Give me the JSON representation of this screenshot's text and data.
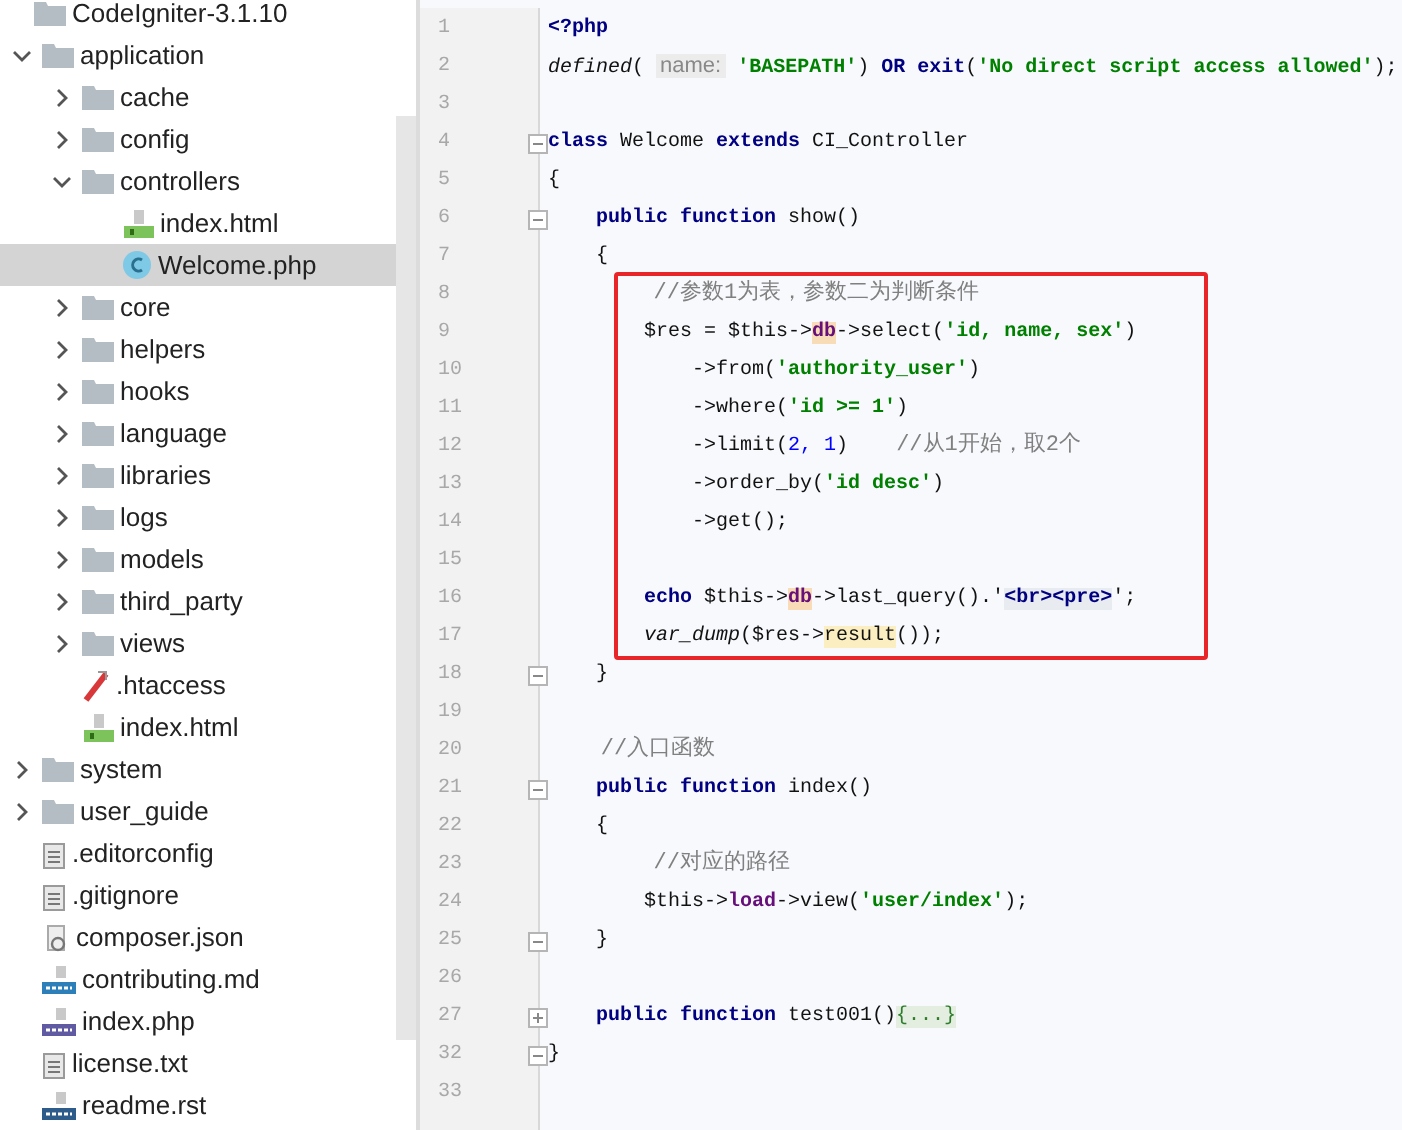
{
  "tree": [
    {
      "label": "CodeIgniter-3.1.10",
      "kind": "folder",
      "selected": false,
      "children": [
        {
          "label": "application",
          "kind": "folder",
          "expanded": true,
          "selected": false,
          "children": [
            {
              "label": "cache",
              "kind": "folder",
              "expanded": false,
              "selected": false
            },
            {
              "label": "config",
              "kind": "folder",
              "expanded": false,
              "selected": false
            },
            {
              "label": "controllers",
              "kind": "folder",
              "expanded": true,
              "selected": false,
              "children": [
                {
                  "label": "index.html",
                  "kind": "html",
                  "selected": false
                },
                {
                  "label": "Welcome.php",
                  "kind": "php-class",
                  "selected": true
                }
              ]
            },
            {
              "label": "core",
              "kind": "folder",
              "expanded": false,
              "selected": false
            },
            {
              "label": "helpers",
              "kind": "folder",
              "expanded": false,
              "selected": false
            },
            {
              "label": "hooks",
              "kind": "folder",
              "expanded": false,
              "selected": false
            },
            {
              "label": "language",
              "kind": "folder",
              "expanded": false,
              "selected": false
            },
            {
              "label": "libraries",
              "kind": "folder",
              "expanded": false,
              "selected": false
            },
            {
              "label": "logs",
              "kind": "folder",
              "expanded": false,
              "selected": false
            },
            {
              "label": "models",
              "kind": "folder",
              "expanded": false,
              "selected": false
            },
            {
              "label": "third_party",
              "kind": "folder",
              "expanded": false,
              "selected": false
            },
            {
              "label": "views",
              "kind": "folder",
              "expanded": false,
              "selected": false
            },
            {
              "label": ".htaccess",
              "kind": "htaccess",
              "selected": false
            },
            {
              "label": "index.html",
              "kind": "html",
              "selected": false
            }
          ]
        },
        {
          "label": "system",
          "kind": "folder",
          "expanded": false,
          "selected": false
        },
        {
          "label": "user_guide",
          "kind": "folder",
          "expanded": false,
          "selected": false
        },
        {
          "label": ".editorconfig",
          "kind": "text",
          "selected": false
        },
        {
          "label": ".gitignore",
          "kind": "text",
          "selected": false
        },
        {
          "label": "composer.json",
          "kind": "json",
          "selected": false
        },
        {
          "label": "contributing.md",
          "kind": "md",
          "selected": false
        },
        {
          "label": "index.php",
          "kind": "php",
          "selected": false
        },
        {
          "label": "license.txt",
          "kind": "text",
          "selected": false
        },
        {
          "label": "readme.rst",
          "kind": "rst",
          "selected": false
        }
      ]
    }
  ],
  "editor": {
    "blocks": [
      {
        "lines": [
          {
            "number": "1",
            "kind": "plain",
            "tokens": [
              {
                "kind": "keyword",
                "text": "<?php"
              }
            ]
          },
          {
            "number": "2",
            "kind": "plain",
            "tokens": [
              {
                "kind": "italic",
                "text": "defined"
              },
              {
                "kind": "plain",
                "text": "( "
              },
              {
                "kind": "hint",
                "text": "name:"
              },
              {
                "kind": "string",
                "text": " 'BASEPATH'"
              },
              {
                "kind": "plain",
                "text": ") "
              },
              {
                "kind": "keyword",
                "text": "OR exit"
              },
              {
                "kind": "plain",
                "text": "("
              },
              {
                "kind": "string",
                "text": "'No direct script access allowed'"
              },
              {
                "kind": "plain",
                "text": ");"
              }
            ]
          },
          {
            "number": "3",
            "kind": "plain"
          },
          {
            "number": "4",
            "kind": "opener",
            "tokens": [
              {
                "kind": "keyword",
                "text": "class"
              },
              {
                "kind": "plain",
                "text": " Welcome "
              },
              {
                "kind": "keyword",
                "text": "extends"
              },
              {
                "kind": "plain",
                "text": " CI_Controller"
              }
            ]
          },
          {
            "number": "5",
            "kind": "plain",
            "tokens": [
              {
                "kind": "plain",
                "text": "{"
              }
            ]
          },
          {
            "number": "6",
            "kind": "opener",
            "tokens": [
              {
                "kind": "keyword",
                "text": "    public function"
              },
              {
                "kind": "plain",
                "text": " show()"
              }
            ]
          },
          {
            "number": "7",
            "kind": "plain",
            "tokens": [
              {
                "kind": "plain",
                "text": "    {"
              }
            ]
          }
        ]
      },
      {
        "boxed": true,
        "lines": [
          {
            "number": "8",
            "kind": "plain",
            "tokens": [
              {
                "kind": "comment",
                "text": "        //参数1为表，参数二为判断条件"
              }
            ]
          },
          {
            "number": "9",
            "kind": "plain",
            "tokens": [
              {
                "kind": "plain",
                "text": "        $res = $this->"
              },
              {
                "kind": "field-marked",
                "text": "db"
              },
              {
                "kind": "plain",
                "text": "->select("
              },
              {
                "kind": "string",
                "text": "'id, name, sex'"
              },
              {
                "kind": "plain",
                "text": ")"
              }
            ]
          },
          {
            "number": "10",
            "kind": "plain",
            "tokens": [
              {
                "kind": "plain",
                "text": "            ->from("
              },
              {
                "kind": "string",
                "text": "'authority_user'"
              },
              {
                "kind": "plain",
                "text": ")"
              }
            ]
          },
          {
            "number": "11",
            "kind": "plain",
            "tokens": [
              {
                "kind": "plain",
                "text": "            ->where("
              },
              {
                "kind": "string",
                "text": "'id >= 1'"
              },
              {
                "kind": "plain",
                "text": ")"
              }
            ]
          },
          {
            "number": "12",
            "kind": "plain",
            "tokens": [
              {
                "kind": "plain",
                "text": "            ->limit("
              },
              {
                "kind": "number",
                "text": "2, 1"
              },
              {
                "kind": "plain",
                "text": ")    "
              },
              {
                "kind": "comment",
                "text": "//从1开始，取2个"
              }
            ]
          },
          {
            "number": "13",
            "kind": "plain",
            "tokens": [
              {
                "kind": "plain",
                "text": "            ->order_by("
              },
              {
                "kind": "string",
                "text": "'id desc'"
              },
              {
                "kind": "plain",
                "text": ")"
              }
            ]
          },
          {
            "number": "14",
            "kind": "plain",
            "tokens": [
              {
                "kind": "plain",
                "text": "            ->get();"
              }
            ]
          },
          {
            "number": "15",
            "kind": "plain"
          },
          {
            "number": "16",
            "kind": "plain",
            "tokens": [
              {
                "kind": "keyword",
                "text": "        echo"
              },
              {
                "kind": "plain",
                "text": " $this->"
              },
              {
                "kind": "field-marked",
                "text": "db"
              },
              {
                "kind": "plain",
                "text": "->last_query().'"
              },
              {
                "kind": "tag",
                "text": "<br><pre>"
              },
              {
                "kind": "plain",
                "text": "';"
              }
            ]
          },
          {
            "number": "17",
            "kind": "plain",
            "tokens": [
              {
                "kind": "italic",
                "text": "        var_dump"
              },
              {
                "kind": "plain",
                "text": "($res->"
              },
              {
                "kind": "match",
                "text": "result"
              },
              {
                "kind": "plain",
                "text": "());"
              }
            ]
          }
        ]
      },
      {
        "lines": [
          {
            "number": "18",
            "kind": "closer",
            "tokens": [
              {
                "kind": "plain",
                "text": "    }"
              }
            ]
          },
          {
            "number": "19",
            "kind": "plain"
          },
          {
            "number": "20",
            "kind": "plain",
            "tokens": [
              {
                "kind": "comment",
                "text": "    //入口函数"
              }
            ]
          },
          {
            "number": "21",
            "kind": "opener",
            "tokens": [
              {
                "kind": "keyword",
                "text": "    public function"
              },
              {
                "kind": "plain",
                "text": " index()"
              }
            ]
          },
          {
            "number": "22",
            "kind": "plain",
            "tokens": [
              {
                "kind": "plain",
                "text": "    {"
              }
            ]
          },
          {
            "number": "23",
            "kind": "plain",
            "tokens": [
              {
                "kind": "comment",
                "text": "        //对应的路径"
              }
            ]
          },
          {
            "number": "24",
            "kind": "plain",
            "tokens": [
              {
                "kind": "plain",
                "text": "        $this->"
              },
              {
                "kind": "field",
                "text": "load"
              },
              {
                "kind": "plain",
                "text": "->view("
              },
              {
                "kind": "string",
                "text": "'user/index'"
              },
              {
                "kind": "plain",
                "text": ");"
              }
            ]
          },
          {
            "number": "25",
            "kind": "closer",
            "tokens": [
              {
                "kind": "plain",
                "text": "    }"
              }
            ]
          },
          {
            "number": "26",
            "kind": "plain"
          },
          {
            "number": "27",
            "kind": "collapsed",
            "tokens": [
              {
                "kind": "keyword",
                "text": "    public function"
              },
              {
                "kind": "plain",
                "text": " test001()"
              },
              {
                "kind": "folded",
                "text": "{...}"
              }
            ]
          },
          {
            "number": "32",
            "kind": "closer",
            "tokens": [
              {
                "kind": "plain",
                "text": "}"
              }
            ]
          },
          {
            "number": "33",
            "kind": "plain"
          }
        ]
      }
    ]
  }
}
